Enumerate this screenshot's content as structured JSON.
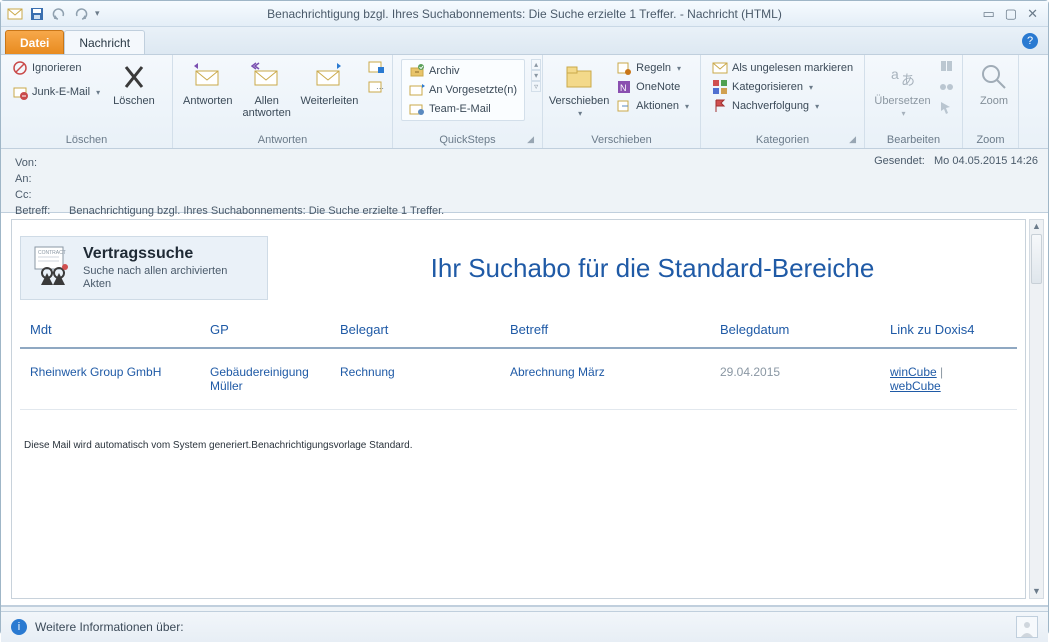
{
  "window": {
    "title": "Benachrichtigung bzgl. Ihres Suchabonnements: Die Suche erzielte 1 Treffer.  -  Nachricht (HTML)"
  },
  "tabs": {
    "datei": "Datei",
    "nachricht": "Nachricht"
  },
  "ribbon": {
    "loeschen_group": "Löschen",
    "ignorieren": "Ignorieren",
    "junk": "Junk-E-Mail",
    "loeschen": "Löschen",
    "antworten_group": "Antworten",
    "antworten": "Antworten",
    "allen": "Allen\nantworten",
    "weiterleiten": "Weiterleiten",
    "quicksteps_group": "QuickSteps",
    "archiv": "Archiv",
    "vorg": "An Vorgesetzte(n)",
    "team": "Team-E-Mail",
    "verschieben_group": "Verschieben",
    "verschieben": "Verschieben",
    "regeln": "Regeln",
    "onenote": "OneNote",
    "aktionen": "Aktionen",
    "kategorien_group": "Kategorien",
    "ungelesen": "Als ungelesen markieren",
    "kategorisieren": "Kategorisieren",
    "nachverfolgung": "Nachverfolgung",
    "bearbeiten_group": "Bearbeiten",
    "uebersetzen": "Übersetzen",
    "zoom_group": "Zoom",
    "zoom": "Zoom"
  },
  "header": {
    "von": "Von:",
    "an": "An:",
    "cc": "Cc:",
    "betreff_lbl": "Betreff:",
    "betreff": "Benachrichtigung bzgl. Ihres Suchabonnements: Die Suche erzielte 1 Treffer.",
    "gesendet_lbl": "Gesendet:",
    "gesendet": "Mo 04.05.2015 14:26"
  },
  "body": {
    "hero_title": "Vertragssuche",
    "hero_sub": "Suche nach allen archivierten Akten",
    "main_title": "Ihr Suchabo für die Standard-Bereiche",
    "cols": {
      "mdt": "Mdt",
      "gp": "GP",
      "belegart": "Belegart",
      "betreff": "Betreff",
      "belegdatum": "Belegdatum",
      "link": "Link zu Doxis4"
    },
    "row": {
      "mdt": "Rheinwerk Group GmbH",
      "gp": "Gebäudereinigung Müller",
      "belegart": "Rechnung",
      "betreff": "Abrechnung März",
      "belegdatum": "29.04.2015",
      "link1": "winCube",
      "link2": "webCube"
    },
    "footnote": "Diese Mail wird automatisch vom System generiert.Benachrichtigungsvorlage Standard."
  },
  "footer": {
    "info": "Weitere Informationen über:"
  }
}
